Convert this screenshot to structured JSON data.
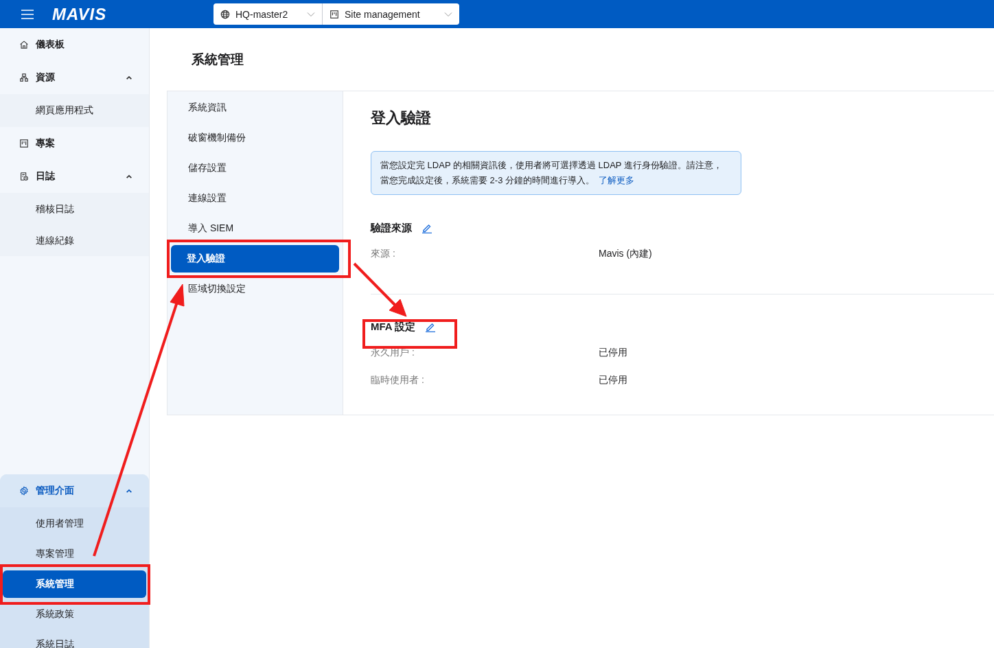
{
  "topbar": {
    "logo": "MAVIS",
    "selectors": [
      {
        "kind": "globe",
        "label": "HQ-master2"
      },
      {
        "kind": "board",
        "label": "Site management"
      }
    ]
  },
  "sidebar": {
    "items": [
      {
        "kind": "home",
        "label": "儀表板",
        "selected": false
      },
      {
        "kind": "resources",
        "label": "資源",
        "expanded": true,
        "children": [
          {
            "label": "網頁應用程式",
            "selected": false
          }
        ]
      },
      {
        "kind": "board",
        "label": "專案",
        "selected": false
      },
      {
        "kind": "log",
        "label": "日誌",
        "expanded": true,
        "children": [
          {
            "label": "稽核日誌",
            "selected": false
          },
          {
            "label": "連線紀錄",
            "selected": false
          }
        ]
      }
    ],
    "admin": {
      "kind": "gear",
      "label": "管理介面",
      "expanded": true,
      "children": [
        {
          "label": "使用者管理",
          "selected": false
        },
        {
          "label": "專案管理",
          "selected": false
        },
        {
          "label": "系統管理",
          "selected": true
        },
        {
          "label": "系統政策",
          "selected": false
        },
        {
          "label": "系統日誌",
          "selected": false
        }
      ]
    }
  },
  "page": {
    "title": "系統管理",
    "subnav": [
      {
        "label": "系統資訊",
        "selected": false
      },
      {
        "label": "破窗機制備份",
        "selected": false
      },
      {
        "label": "儲存設置",
        "selected": false
      },
      {
        "label": "連線設置",
        "selected": false
      },
      {
        "label": "導入 SIEM",
        "selected": false
      },
      {
        "label": "登入驗證",
        "selected": true
      },
      {
        "label": "區域切換設定",
        "selected": false
      }
    ],
    "content": {
      "title": "登入驗證",
      "info": {
        "text": "當您設定完 LDAP 的相關資訊後，使用者將可選擇透過 LDAP 進行身份驗證。請注意，當您完成設定後，系統需要 2-3 分鐘的時間進行導入。",
        "link": "了解更多"
      },
      "sections": [
        {
          "title": "驗證來源",
          "rows": [
            {
              "label": "來源 :",
              "value": "Mavis (內建)"
            }
          ]
        },
        {
          "title": "MFA 設定",
          "rows": [
            {
              "label": "永久用戶 :",
              "value": "已停用"
            },
            {
              "label": "臨時使用者 :",
              "value": "已停用"
            }
          ]
        }
      ]
    }
  },
  "annotations": [
    {
      "kind": "box"
    },
    {
      "kind": "box"
    },
    {
      "kind": "box"
    },
    {
      "kind": "arrow"
    },
    {
      "kind": "arrow"
    }
  ]
}
